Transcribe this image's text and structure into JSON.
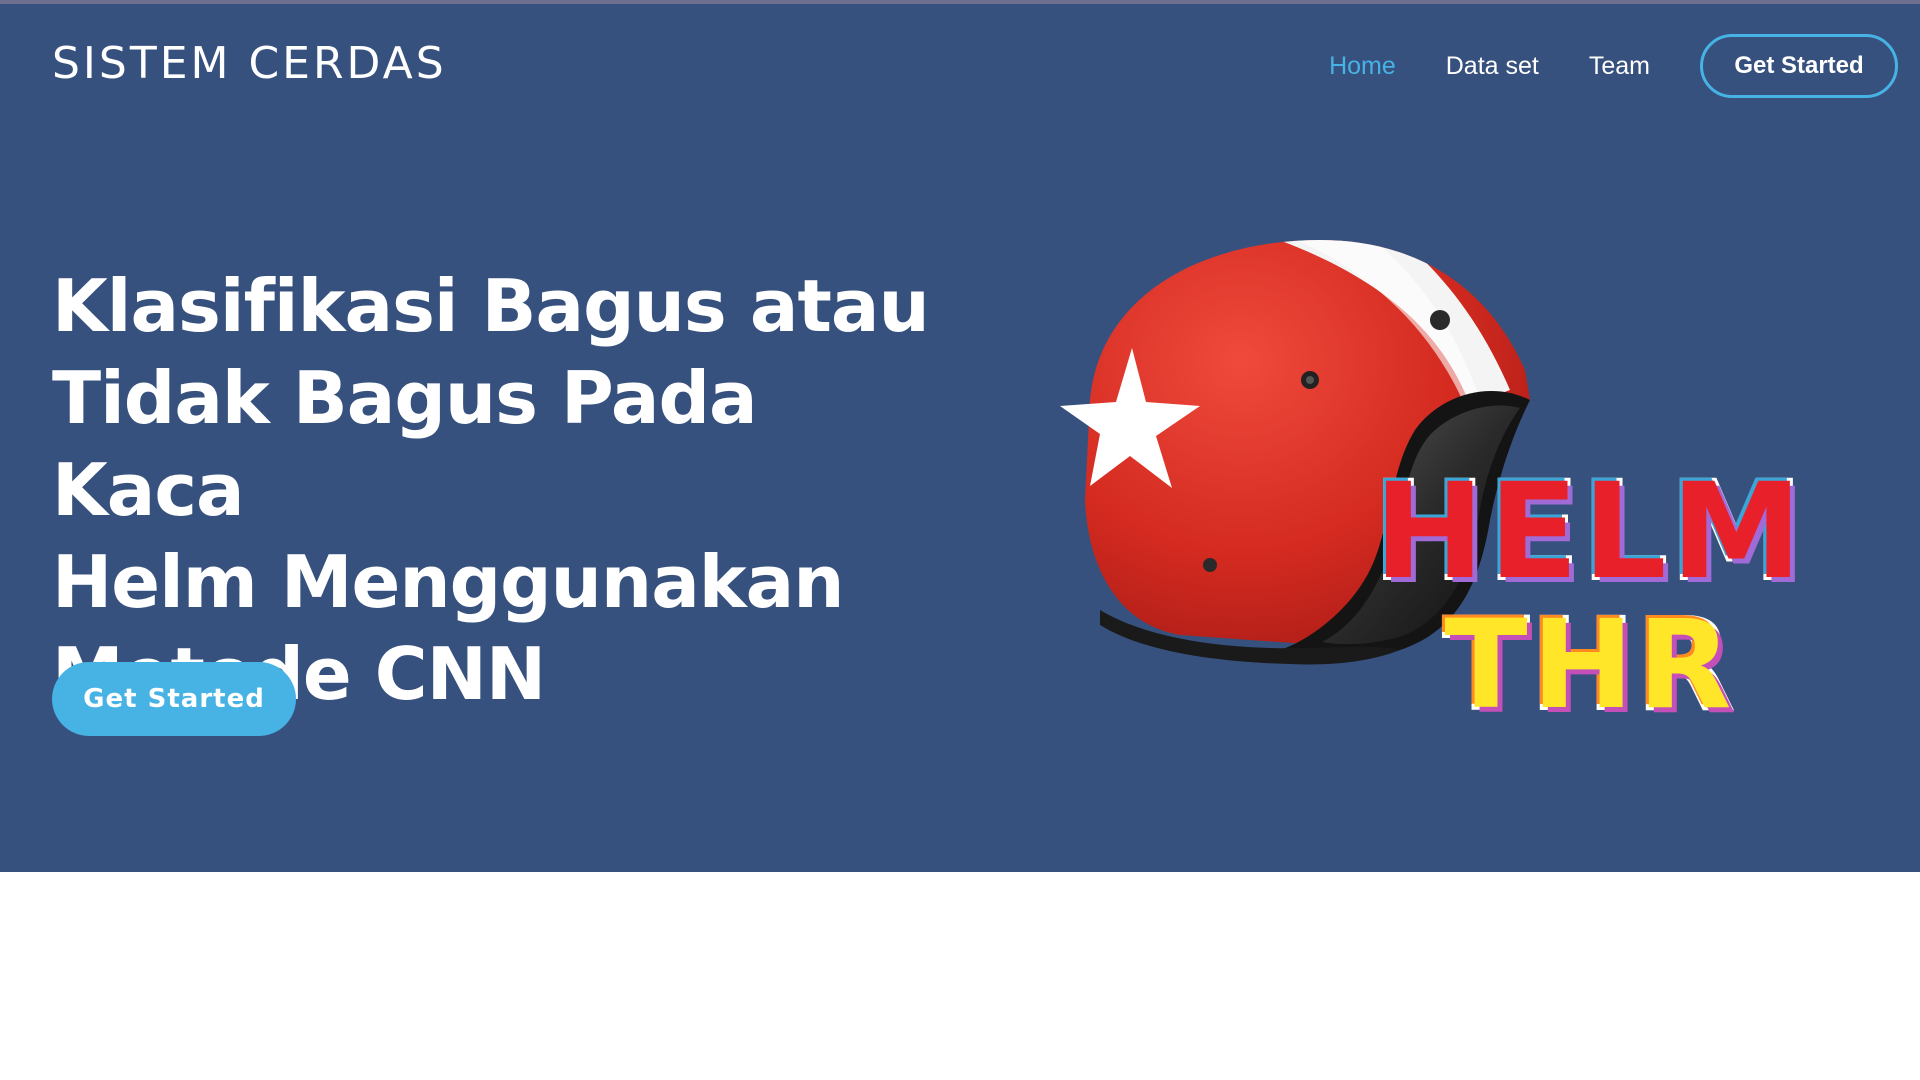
{
  "header": {
    "brand": "SISTEM CERDAS",
    "nav": [
      {
        "label": "Home",
        "active": true
      },
      {
        "label": "Data set",
        "active": false
      },
      {
        "label": "Team",
        "active": false
      }
    ],
    "cta_label": "Get Started"
  },
  "hero": {
    "title_lines": [
      "Klasifikasi Bagus atau",
      "Tidak Bagus Pada Kaca",
      "Helm Menggunakan",
      "Metode CNN"
    ],
    "cta_label": "Get Started",
    "illustration": {
      "icon": "helmet-icon",
      "logo_line1": "HELM",
      "logo_line2": "THR"
    }
  },
  "colors": {
    "hero_background": "#37517e",
    "accent": "#47b2e4",
    "text": "#ffffff",
    "helmet_red": "#d42a20",
    "logo_red": "#e8202a",
    "logo_yellow": "#ffe629"
  }
}
